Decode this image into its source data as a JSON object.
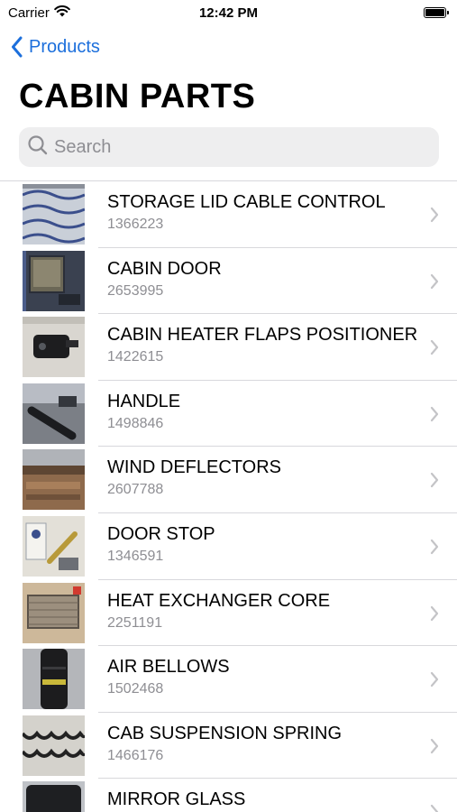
{
  "status": {
    "carrier": "Carrier",
    "time": "12:42 PM"
  },
  "nav": {
    "back_label": "Products"
  },
  "page": {
    "title": "CABIN PARTS"
  },
  "search": {
    "placeholder": "Search"
  },
  "products": [
    {
      "name": "STORAGE LID CABLE CONTROL",
      "code": "1366223"
    },
    {
      "name": "CABIN DOOR",
      "code": "2653995"
    },
    {
      "name": "CABIN HEATER FLAPS POSITIONER",
      "code": "1422615"
    },
    {
      "name": "HANDLE",
      "code": "1498846"
    },
    {
      "name": "WIND DEFLECTORS",
      "code": "2607788"
    },
    {
      "name": "DOOR STOP",
      "code": "1346591"
    },
    {
      "name": "HEAT EXCHANGER CORE",
      "code": "2251191"
    },
    {
      "name": "AIR BELLOWS",
      "code": "1502468"
    },
    {
      "name": "CAB SUSPENSION SPRING",
      "code": "1466176"
    },
    {
      "name": "MIRROR GLASS",
      "code": ""
    }
  ],
  "colors": {
    "accent": "#1c6fdc",
    "secondary_text": "#8e8e93",
    "separator": "#d8d8dc",
    "search_bg": "#eeeeef"
  }
}
